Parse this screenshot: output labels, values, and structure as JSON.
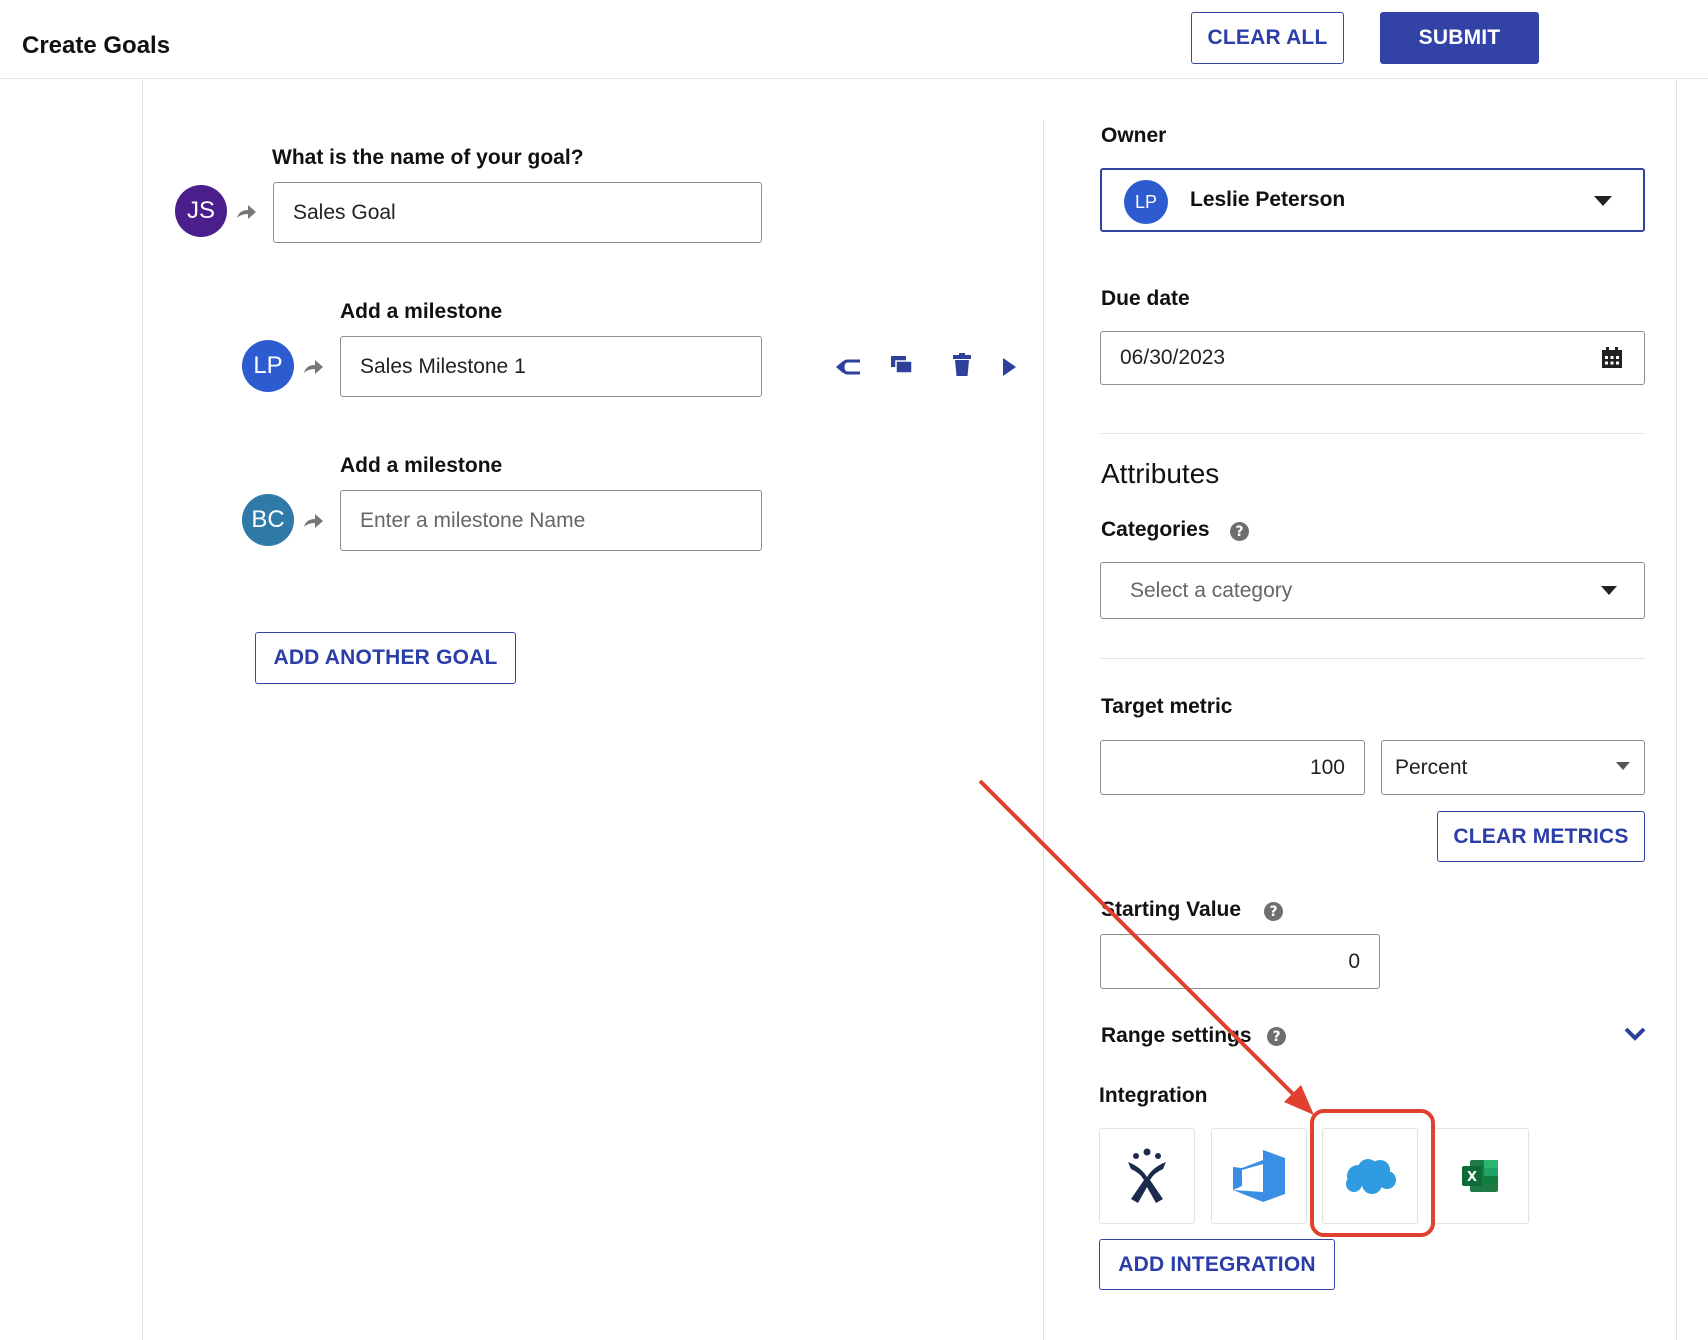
{
  "header": {
    "title": "Create Goals",
    "clear_all_label": "CLEAR ALL",
    "submit_label": "SUBMIT"
  },
  "goal": {
    "question": "What is the name of your goal?",
    "avatar_initials": "JS",
    "avatar_color": "#4a1f8c",
    "name_value": "Sales Goal"
  },
  "milestones": [
    {
      "label": "Add a milestone",
      "avatar_initials": "LP",
      "avatar_color": "#2d5bd0",
      "value": "Sales Milestone 1",
      "placeholder": ""
    },
    {
      "label": "Add a milestone",
      "avatar_initials": "BC",
      "avatar_color": "#2f7aa8",
      "value": "",
      "placeholder": "Enter a milestone Name"
    }
  ],
  "milestone_tools": [
    "split-icon",
    "duplicate-icon",
    "trash-icon",
    "play-icon"
  ],
  "add_goal_label": "ADD ANOTHER GOAL",
  "sidebar": {
    "owner_label": "Owner",
    "owner_initials": "LP",
    "owner_name": "Leslie Peterson",
    "due_label": "Due date",
    "due_value": "06/30/2023",
    "attributes_heading": "Attributes",
    "categories_label": "Categories",
    "category_placeholder": "Select a category",
    "target_label": "Target metric",
    "target_value": "100",
    "target_unit": "Percent",
    "clear_metrics_label": "CLEAR METRICS",
    "starting_label": "Starting Value",
    "starting_value": "0",
    "range_label": "Range settings",
    "integration_label": "Integration",
    "integrations": [
      "jira",
      "azure-devops",
      "salesforce",
      "excel"
    ],
    "add_integration_label": "ADD INTEGRATION"
  },
  "colors": {
    "accent": "#3242a6",
    "annotation": "#e04030"
  }
}
